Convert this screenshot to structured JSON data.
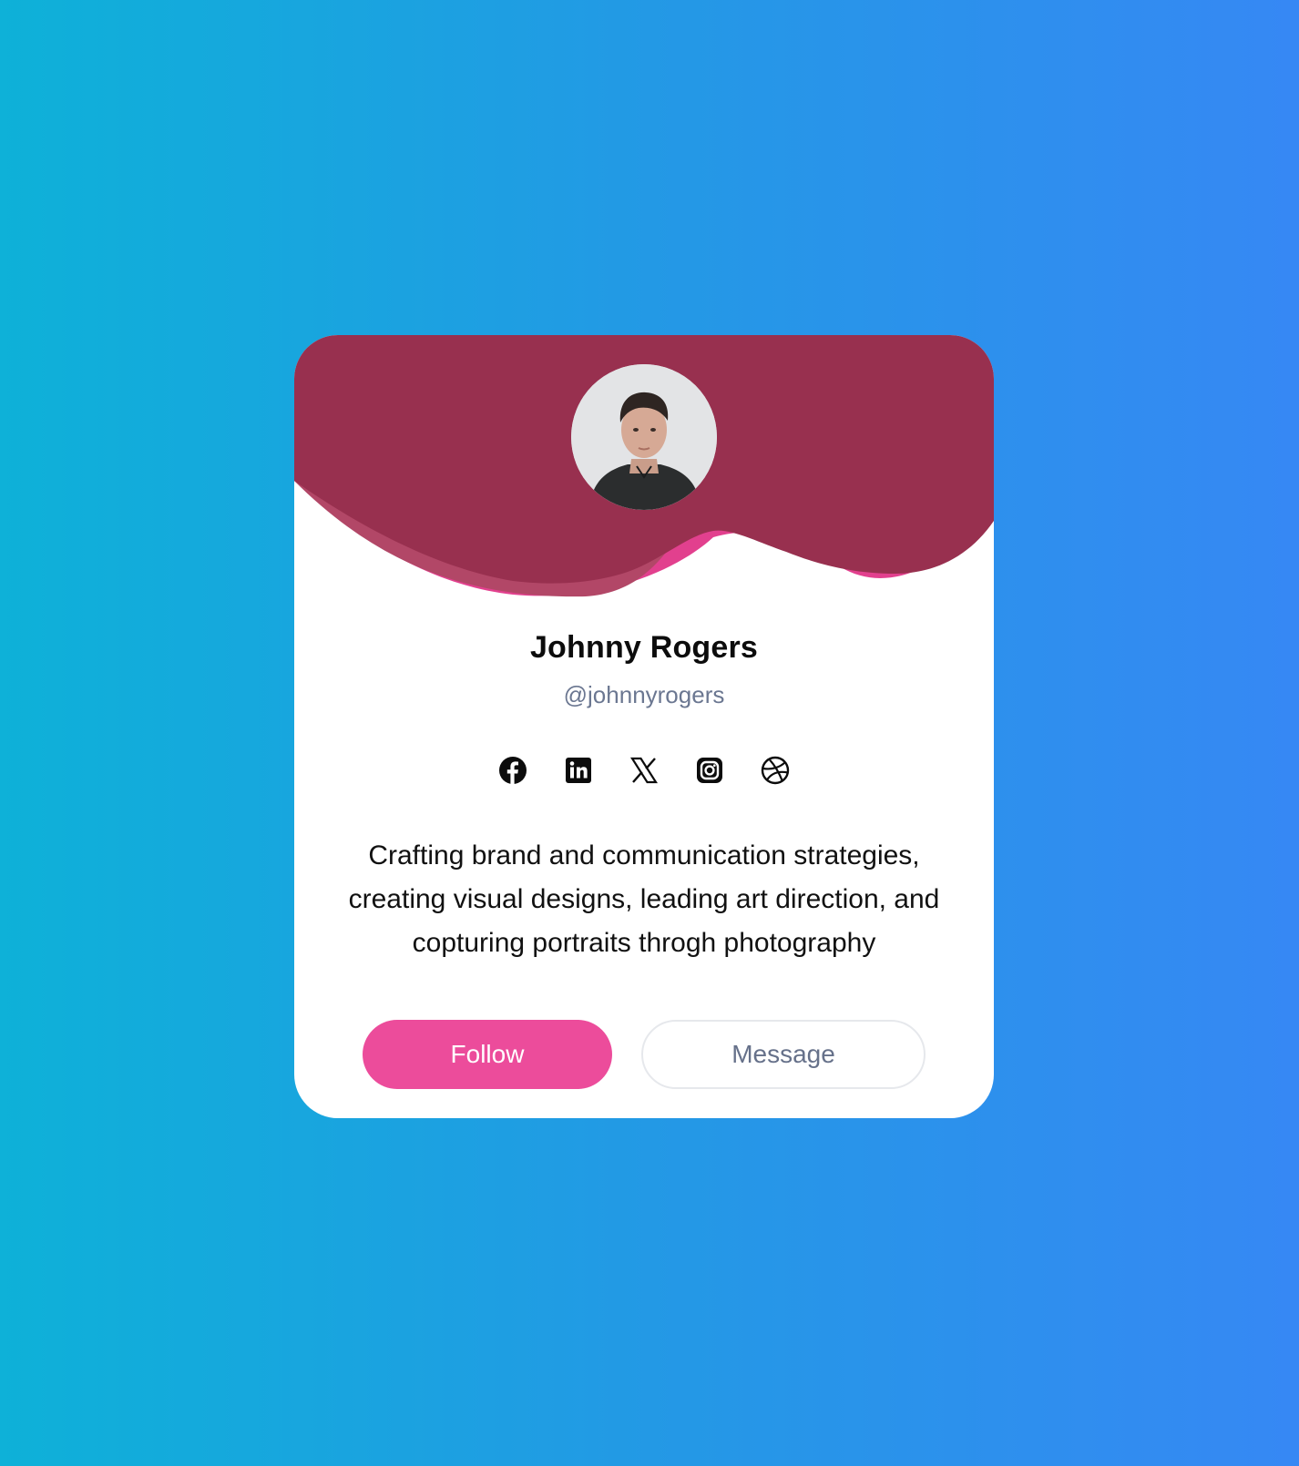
{
  "profile": {
    "name": "Johnny Rogers",
    "handle": "@johnnyrogers",
    "bio": "Crafting brand and communication strategies, creating visual designs, leading art direction, and copturing portraits throgh photography",
    "avatar_alt": "Johnny Rogers portrait"
  },
  "socials": [
    {
      "name": "facebook-icon",
      "label": "Facebook"
    },
    {
      "name": "linkedin-icon",
      "label": "LinkedIn"
    },
    {
      "name": "x-icon",
      "label": "X"
    },
    {
      "name": "instagram-icon",
      "label": "Instagram"
    },
    {
      "name": "dribbble-icon",
      "label": "Dribbble"
    }
  ],
  "actions": {
    "follow_label": "Follow",
    "message_label": "Message"
  },
  "colors": {
    "background_start": "#0eb1d8",
    "background_end": "#3688f4",
    "header_dark": "#98304f",
    "header_pink": "#e2408e",
    "header_mid": "#b24767",
    "follow_button": "#ec4c9b",
    "handle_text": "#6b7791"
  }
}
